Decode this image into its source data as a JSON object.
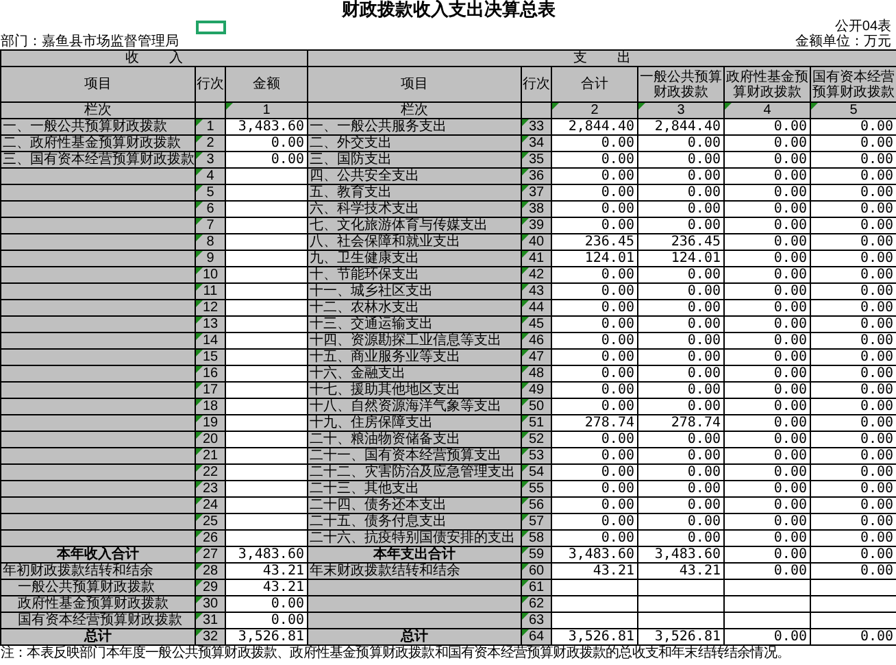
{
  "title": "财政拨款收入支出决算总表",
  "form_no": "公开04表",
  "department": "部门：嘉鱼县市场监督管理局",
  "unit": "金额单位：万元",
  "income_header": "收        入",
  "expense_header": "支        出",
  "income_columns": [
    "项目",
    "行次",
    "金额"
  ],
  "expense_columns": [
    "项目",
    "行次",
    "合计",
    "一般公共预算财政拨款",
    "政府性基金预算财政拨款",
    "国有资本经营预算财政拨款"
  ],
  "column_numbers": {
    "income_label": "栏次",
    "income": [
      "1"
    ],
    "expense_label": "栏次",
    "expense": [
      "2",
      "3",
      "4",
      "5"
    ]
  },
  "rows": [
    {
      "income": {
        "kind": "normal",
        "item": "一、一般公共预算财政拨款",
        "line": "1",
        "amount": "3,483.60"
      },
      "expense": {
        "kind": "normal",
        "item": "一、一般公共服务支出",
        "line": "33",
        "values": [
          "2,844.40",
          "2,844.40",
          "0.00",
          "0.00"
        ]
      }
    },
    {
      "income": {
        "kind": "normal",
        "item": "二、政府性基金预算财政拨款",
        "line": "2",
        "amount": "0.00"
      },
      "expense": {
        "kind": "normal",
        "item": "二、外交支出",
        "line": "34",
        "values": [
          "0.00",
          "0.00",
          "0.00",
          "0.00"
        ]
      }
    },
    {
      "income": {
        "kind": "normal",
        "item": "三、国有资本经营预算财政拨款",
        "line": "3",
        "amount": "0.00"
      },
      "expense": {
        "kind": "normal",
        "item": "三、国防支出",
        "line": "35",
        "values": [
          "0.00",
          "0.00",
          "0.00",
          "0.00"
        ]
      }
    },
    {
      "income": {
        "kind": "normal",
        "line": "4"
      },
      "expense": {
        "kind": "normal",
        "item": "四、公共安全支出",
        "line": "36",
        "values": [
          "0.00",
          "0.00",
          "0.00",
          "0.00"
        ]
      }
    },
    {
      "income": {
        "kind": "normal",
        "line": "5"
      },
      "expense": {
        "kind": "normal",
        "item": "五、教育支出",
        "line": "37",
        "values": [
          "0.00",
          "0.00",
          "0.00",
          "0.00"
        ]
      }
    },
    {
      "income": {
        "kind": "normal",
        "line": "6"
      },
      "expense": {
        "kind": "normal",
        "item": "六、科学技术支出",
        "line": "38",
        "values": [
          "0.00",
          "0.00",
          "0.00",
          "0.00"
        ]
      }
    },
    {
      "income": {
        "kind": "normal",
        "line": "7"
      },
      "expense": {
        "kind": "normal",
        "item": "七、文化旅游体育与传媒支出",
        "line": "39",
        "values": [
          "0.00",
          "0.00",
          "0.00",
          "0.00"
        ]
      }
    },
    {
      "income": {
        "kind": "normal",
        "line": "8"
      },
      "expense": {
        "kind": "normal",
        "item": "八、社会保障和就业支出",
        "line": "40",
        "values": [
          "236.45",
          "236.45",
          "0.00",
          "0.00"
        ]
      }
    },
    {
      "income": {
        "kind": "normal",
        "line": "9"
      },
      "expense": {
        "kind": "normal",
        "item": "九、卫生健康支出",
        "line": "41",
        "values": [
          "124.01",
          "124.01",
          "0.00",
          "0.00"
        ]
      }
    },
    {
      "income": {
        "kind": "normal",
        "line": "10"
      },
      "expense": {
        "kind": "normal",
        "item": "十、节能环保支出",
        "line": "42",
        "values": [
          "0.00",
          "0.00",
          "0.00",
          "0.00"
        ]
      }
    },
    {
      "income": {
        "kind": "normal",
        "line": "11"
      },
      "expense": {
        "kind": "normal",
        "item": "十一、城乡社区支出",
        "line": "43",
        "values": [
          "0.00",
          "0.00",
          "0.00",
          "0.00"
        ]
      }
    },
    {
      "income": {
        "kind": "normal",
        "line": "12"
      },
      "expense": {
        "kind": "normal",
        "item": "十二、农林水支出",
        "line": "44",
        "values": [
          "0.00",
          "0.00",
          "0.00",
          "0.00"
        ]
      }
    },
    {
      "income": {
        "kind": "normal",
        "line": "13"
      },
      "expense": {
        "kind": "normal",
        "item": "十三、交通运输支出",
        "line": "45",
        "values": [
          "0.00",
          "0.00",
          "0.00",
          "0.00"
        ]
      }
    },
    {
      "income": {
        "kind": "normal",
        "line": "14"
      },
      "expense": {
        "kind": "normal",
        "item": "十四、资源勘探工业信息等支出",
        "line": "46",
        "values": [
          "0.00",
          "0.00",
          "0.00",
          "0.00"
        ]
      }
    },
    {
      "income": {
        "kind": "normal",
        "line": "15"
      },
      "expense": {
        "kind": "normal",
        "item": "十五、商业服务业等支出",
        "line": "47",
        "values": [
          "0.00",
          "0.00",
          "0.00",
          "0.00"
        ]
      }
    },
    {
      "income": {
        "kind": "normal",
        "line": "16"
      },
      "expense": {
        "kind": "normal",
        "item": "十六、金融支出",
        "line": "48",
        "values": [
          "0.00",
          "0.00",
          "0.00",
          "0.00"
        ]
      }
    },
    {
      "income": {
        "kind": "normal",
        "line": "17"
      },
      "expense": {
        "kind": "normal",
        "item": "十七、援助其他地区支出",
        "line": "49",
        "values": [
          "0.00",
          "0.00",
          "0.00",
          "0.00"
        ]
      }
    },
    {
      "income": {
        "kind": "normal",
        "line": "18"
      },
      "expense": {
        "kind": "normal",
        "item": "十八、自然资源海洋气象等支出",
        "line": "50",
        "values": [
          "0.00",
          "0.00",
          "0.00",
          "0.00"
        ]
      }
    },
    {
      "income": {
        "kind": "normal",
        "line": "19"
      },
      "expense": {
        "kind": "normal",
        "item": "十九、住房保障支出",
        "line": "51",
        "values": [
          "278.74",
          "278.74",
          "0.00",
          "0.00"
        ]
      }
    },
    {
      "income": {
        "kind": "normal",
        "line": "20"
      },
      "expense": {
        "kind": "normal",
        "item": "二十、粮油物资储备支出",
        "line": "52",
        "values": [
          "0.00",
          "0.00",
          "0.00",
          "0.00"
        ]
      }
    },
    {
      "income": {
        "kind": "normal",
        "line": "21"
      },
      "expense": {
        "kind": "normal",
        "item": "二十一、国有资本经营预算支出",
        "line": "53",
        "values": [
          "0.00",
          "0.00",
          "0.00",
          "0.00"
        ]
      }
    },
    {
      "income": {
        "kind": "normal",
        "line": "22"
      },
      "expense": {
        "kind": "normal",
        "item": "二十二、灾害防治及应急管理支出",
        "line": "54",
        "values": [
          "0.00",
          "0.00",
          "0.00",
          "0.00"
        ]
      }
    },
    {
      "income": {
        "kind": "normal",
        "line": "23"
      },
      "expense": {
        "kind": "normal",
        "item": "二十三、其他支出",
        "line": "55",
        "values": [
          "0.00",
          "0.00",
          "0.00",
          "0.00"
        ]
      }
    },
    {
      "income": {
        "kind": "normal",
        "line": "24"
      },
      "expense": {
        "kind": "normal",
        "item": "二十四、债务还本支出",
        "line": "56",
        "values": [
          "0.00",
          "0.00",
          "0.00",
          "0.00"
        ]
      }
    },
    {
      "income": {
        "kind": "normal",
        "line": "25"
      },
      "expense": {
        "kind": "normal",
        "item": "二十五、债务付息支出",
        "line": "57",
        "values": [
          "0.00",
          "0.00",
          "0.00",
          "0.00"
        ]
      }
    },
    {
      "income": {
        "kind": "normal",
        "line": "26"
      },
      "expense": {
        "kind": "normal",
        "item": "二十六、抗疫特别国债安排的支出",
        "line": "58",
        "values": [
          "0.00",
          "0.00",
          "0.00",
          "0.00"
        ]
      }
    },
    {
      "income": {
        "kind": "total",
        "item": "本年收入合计",
        "line": "27",
        "amount": "3,483.60"
      },
      "expense": {
        "kind": "total",
        "item": "本年支出合计",
        "line": "59",
        "values": [
          "3,483.60",
          "3,483.60",
          "0.00",
          "0.00"
        ]
      }
    },
    {
      "income": {
        "kind": "normal",
        "item": "年初财政拨款结转和结余",
        "line": "28",
        "amount": "43.21"
      },
      "expense": {
        "kind": "normal",
        "item": "年末财政拨款结转和结余",
        "line": "60",
        "values": [
          "43.21",
          "43.21",
          "0.00",
          "0.00"
        ]
      }
    },
    {
      "income": {
        "kind": "sub",
        "item": "一般公共预算财政拨款",
        "line": "29",
        "amount": "43.21"
      },
      "expense": {
        "kind": "normal",
        "line": "61"
      }
    },
    {
      "income": {
        "kind": "sub",
        "item": "政府性基金预算财政拨款",
        "line": "30",
        "amount": "0.00"
      },
      "expense": {
        "kind": "normal",
        "line": "62"
      }
    },
    {
      "income": {
        "kind": "sub",
        "item": "国有资本经营预算财政拨款",
        "line": "31",
        "amount": "0.00"
      },
      "expense": {
        "kind": "normal",
        "line": "63"
      }
    },
    {
      "income": {
        "kind": "total",
        "item": "总计",
        "line": "32",
        "amount": "3,526.81"
      },
      "expense": {
        "kind": "total",
        "item": "总计",
        "line": "64",
        "values": [
          "3,526.81",
          "3,526.81",
          "0.00",
          "0.00"
        ]
      }
    }
  ],
  "note": "注：本表反映部门本年度一般公共预算财政拨款、政府性基金预算财政拨款和国有资本经营预算财政拨款的总收支和年末结转结余情况。"
}
